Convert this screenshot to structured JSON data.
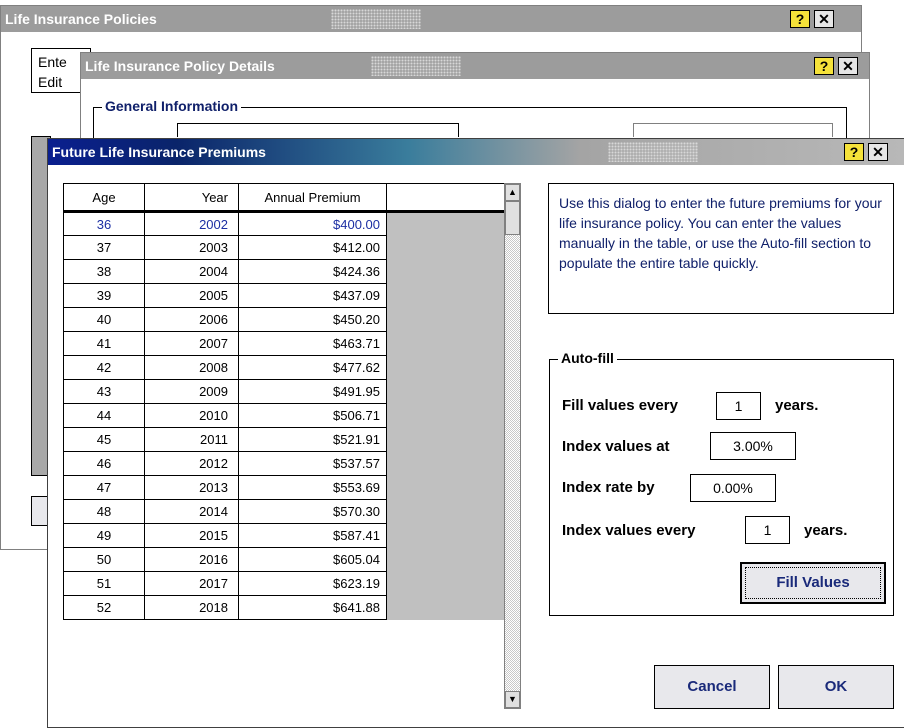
{
  "window_back": {
    "title": "Life Insurance Policies",
    "line1": "Ente",
    "line2": "Edit"
  },
  "window_mid": {
    "title": "Life Insurance Policy Details",
    "group_title": "General Information"
  },
  "dialog": {
    "title": "Future Life Insurance Premiums",
    "help_label": "?",
    "close_label": "✕",
    "info_text": "Use this dialog to enter the future premiums for your life insurance policy. You can enter the values manually in the table, or use the Auto-fill section to populate the entire table quickly.",
    "table": {
      "headers": [
        "Age",
        "Year",
        "Annual Premium",
        ""
      ],
      "rows": [
        [
          "36",
          "2002",
          "$400.00"
        ],
        [
          "37",
          "2003",
          "$412.00"
        ],
        [
          "38",
          "2004",
          "$424.36"
        ],
        [
          "39",
          "2005",
          "$437.09"
        ],
        [
          "40",
          "2006",
          "$450.20"
        ],
        [
          "41",
          "2007",
          "$463.71"
        ],
        [
          "42",
          "2008",
          "$477.62"
        ],
        [
          "43",
          "2009",
          "$491.95"
        ],
        [
          "44",
          "2010",
          "$506.71"
        ],
        [
          "45",
          "2011",
          "$521.91"
        ],
        [
          "46",
          "2012",
          "$537.57"
        ],
        [
          "47",
          "2013",
          "$553.69"
        ],
        [
          "48",
          "2014",
          "$570.30"
        ],
        [
          "49",
          "2015",
          "$587.41"
        ],
        [
          "50",
          "2016",
          "$605.04"
        ],
        [
          "51",
          "2017",
          "$623.19"
        ],
        [
          "52",
          "2018",
          "$641.88"
        ]
      ]
    },
    "autofill": {
      "title": "Auto-fill",
      "fill_every_label": "Fill values every",
      "fill_every_value": "1",
      "years_label": "years.",
      "index_at_label": "Index values at",
      "index_at_value": "3.00%",
      "index_rate_label": "Index rate by",
      "index_rate_value": "0.00%",
      "index_every_label": "Index values every",
      "index_every_value": "1",
      "years_label2": "years.",
      "fill_button": "Fill Values"
    },
    "cancel_button": "Cancel",
    "ok_button": "OK"
  },
  "colors": {
    "first_row_text": "#1c2fa3",
    "gray_column": "#c0c0c0",
    "button_text": "#1a2a7a"
  }
}
